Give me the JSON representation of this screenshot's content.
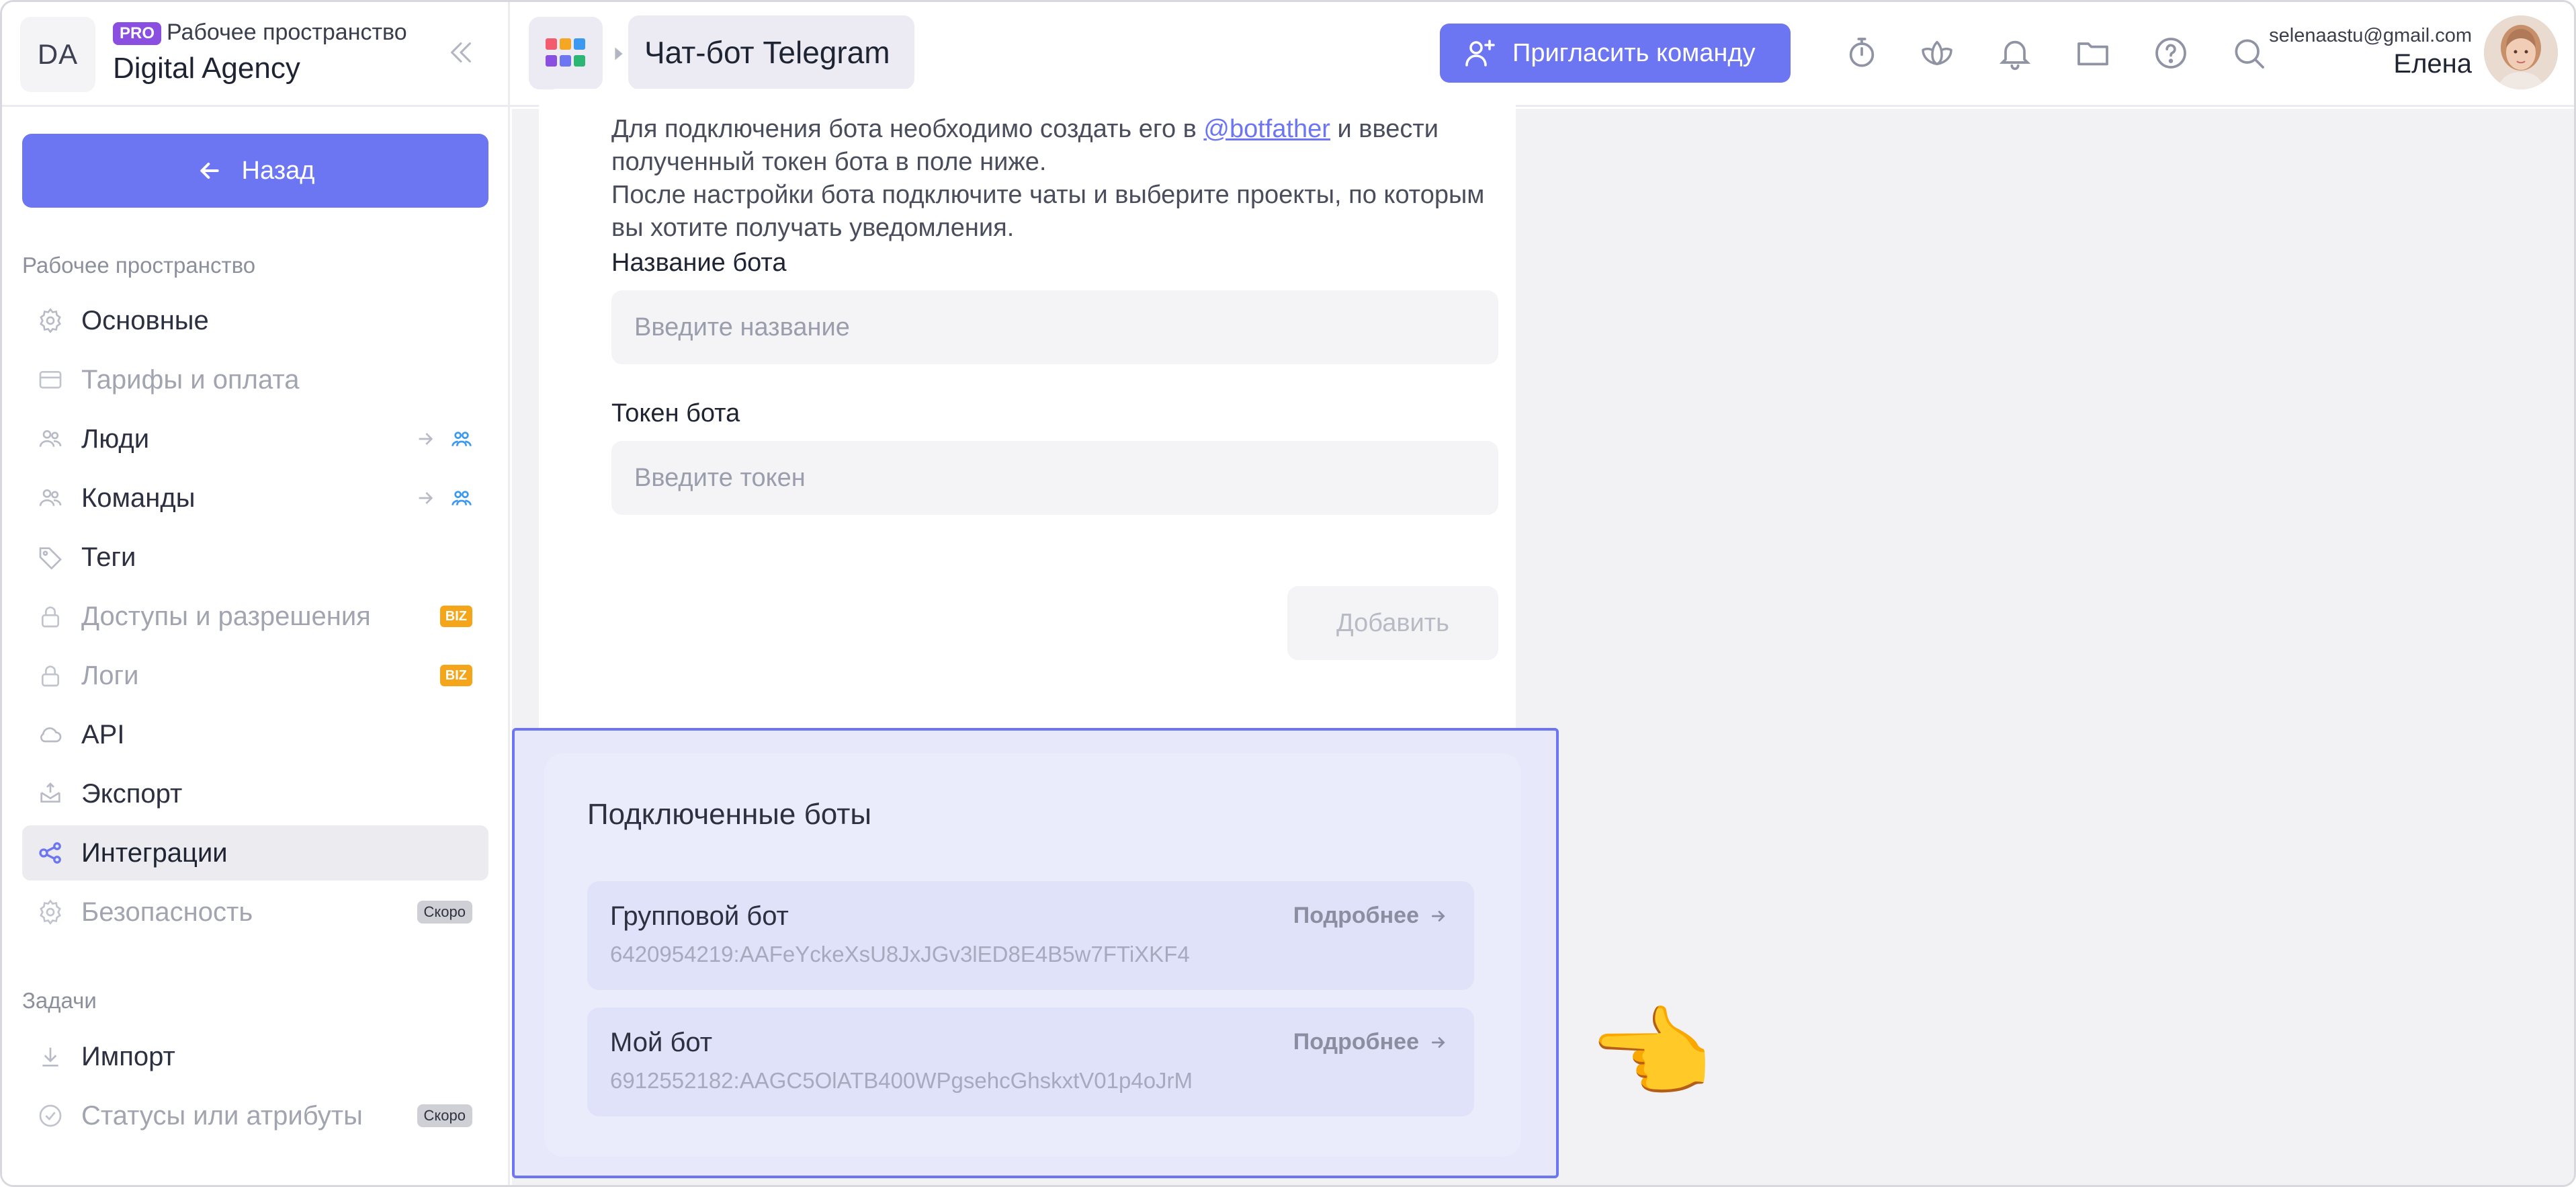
{
  "workspace": {
    "initials": "DA",
    "plan_badge": "PRO",
    "subtitle": "Рабочее пространство",
    "name": "Digital Agency"
  },
  "sidebar": {
    "back_label": "Назад",
    "section_workspace": "Рабочее пространство",
    "items": [
      {
        "label": "Основные",
        "icon": "gear-icon"
      },
      {
        "label": "Тарифы и оплата",
        "icon": "card-icon"
      },
      {
        "label": "Люди",
        "icon": "people-icon"
      },
      {
        "label": "Команды",
        "icon": "team-icon"
      },
      {
        "label": "Теги",
        "icon": "tag-icon"
      },
      {
        "label": "Доступы и разрешения",
        "icon": "lock-icon",
        "badge": "BIZ"
      },
      {
        "label": "Логи",
        "icon": "lock-icon",
        "badge": "BIZ"
      },
      {
        "label": "API",
        "icon": "cloud-icon"
      },
      {
        "label": "Экспорт",
        "icon": "export-icon"
      },
      {
        "label": "Интеграции",
        "icon": "integrations-icon"
      },
      {
        "label": "Безопасность",
        "icon": "gear-icon",
        "badge": "Скоро"
      }
    ],
    "section_tasks": "Задачи",
    "task_items": [
      {
        "label": "Импорт",
        "icon": "import-icon"
      },
      {
        "label": "Статусы или атрибуты",
        "icon": "status-icon",
        "badge": "Скоро"
      }
    ]
  },
  "topbar": {
    "page_title": "Чат-бот Telegram",
    "invite_label": "Пригласить команду",
    "icons": [
      "timer-icon",
      "lotus-icon",
      "bell-icon",
      "folder-icon",
      "help-icon",
      "search-icon"
    ],
    "user_email": "selenaastu@gmail.com",
    "user_name": "Елена"
  },
  "setup": {
    "desc_part1": "Для подключения бота необходимо создать его в ",
    "desc_link": "@botfather",
    "desc_part2": " и ввести полученный токен бота в поле ниже.",
    "desc_line2": "После настройки бота подключите чаты и выберите проекты, по которым вы хотите получать уведомления.",
    "name_label": "Название бота",
    "name_placeholder": "Введите название",
    "token_label": "Токен бота",
    "token_placeholder": "Введите токен",
    "add_label": "Добавить"
  },
  "connected": {
    "title": "Подключенные боты",
    "more_label": "Подробнее",
    "bots": [
      {
        "name": "Групповой бот",
        "token": "6420954219:AAFeYckeXsU8JxJGv3lED8E4B5w7FTiXKF4"
      },
      {
        "name": "Мой бот",
        "token": "6912552182:AAGC5OlATB400WPgsehcGhskxtV01p4oJrM"
      }
    ]
  },
  "pointer": "👈"
}
